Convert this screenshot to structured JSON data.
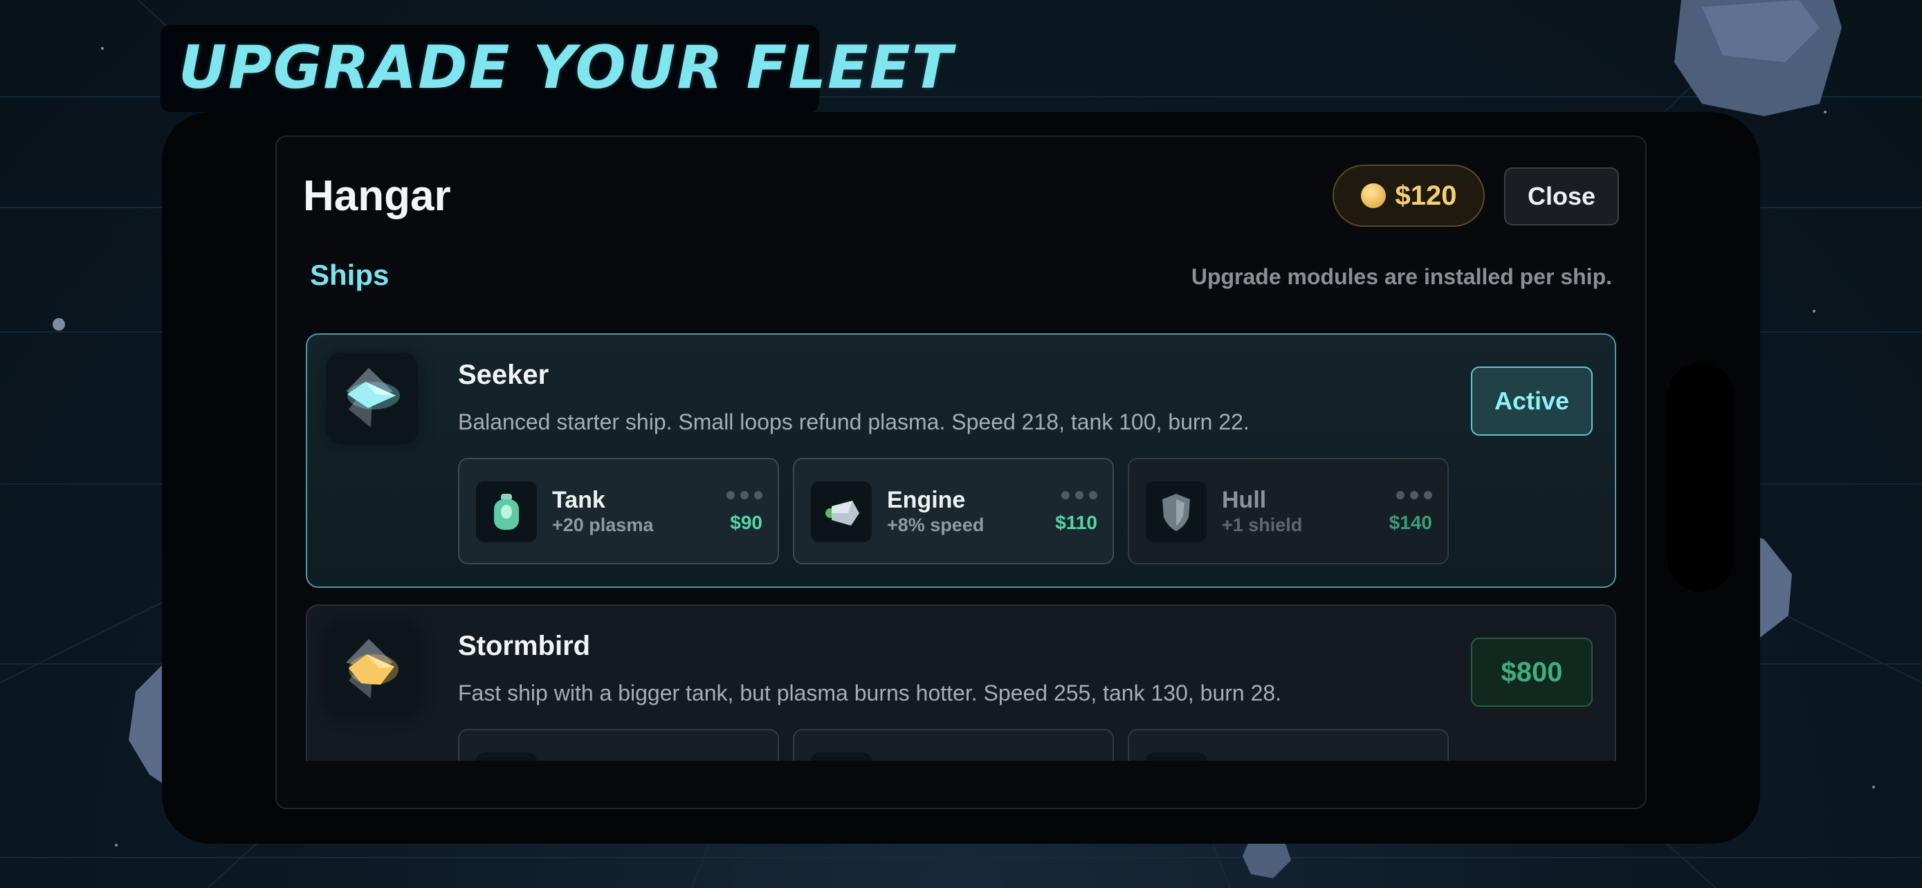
{
  "screen_title": "UPGRADE YOUR FLEET",
  "panel": {
    "title": "Hangar",
    "money": "$120",
    "close_label": "Close",
    "section_label": "Ships",
    "hint": "Upgrade modules are installed per ship."
  },
  "ships": [
    {
      "name": "Seeker",
      "description": "Balanced starter ship. Small loops refund plasma. Speed 218, tank 100, burn 22.",
      "status": "Active",
      "icon": "ship-seeker-icon",
      "accent": "#7fe6ef",
      "modules": [
        {
          "name": "Tank",
          "effect": "+20 plasma",
          "price": "$90",
          "icon": "tank-icon"
        },
        {
          "name": "Engine",
          "effect": "+8% speed",
          "price": "$110",
          "icon": "engine-icon"
        },
        {
          "name": "Hull",
          "effect": "+1 shield",
          "price": "$140",
          "icon": "shield-icon"
        }
      ]
    },
    {
      "name": "Stormbird",
      "description": "Fast ship with a bigger tank, but plasma burns hotter. Speed 255, tank 130, burn 28.",
      "status": "$800",
      "icon": "ship-stormbird-icon",
      "accent": "#f5c96a"
    }
  ],
  "colors": {
    "title": "#7fe6ef",
    "accent_cyan": "#79e4ee",
    "money_gold": "#f5cf73",
    "price_green": "#55d6a8"
  }
}
